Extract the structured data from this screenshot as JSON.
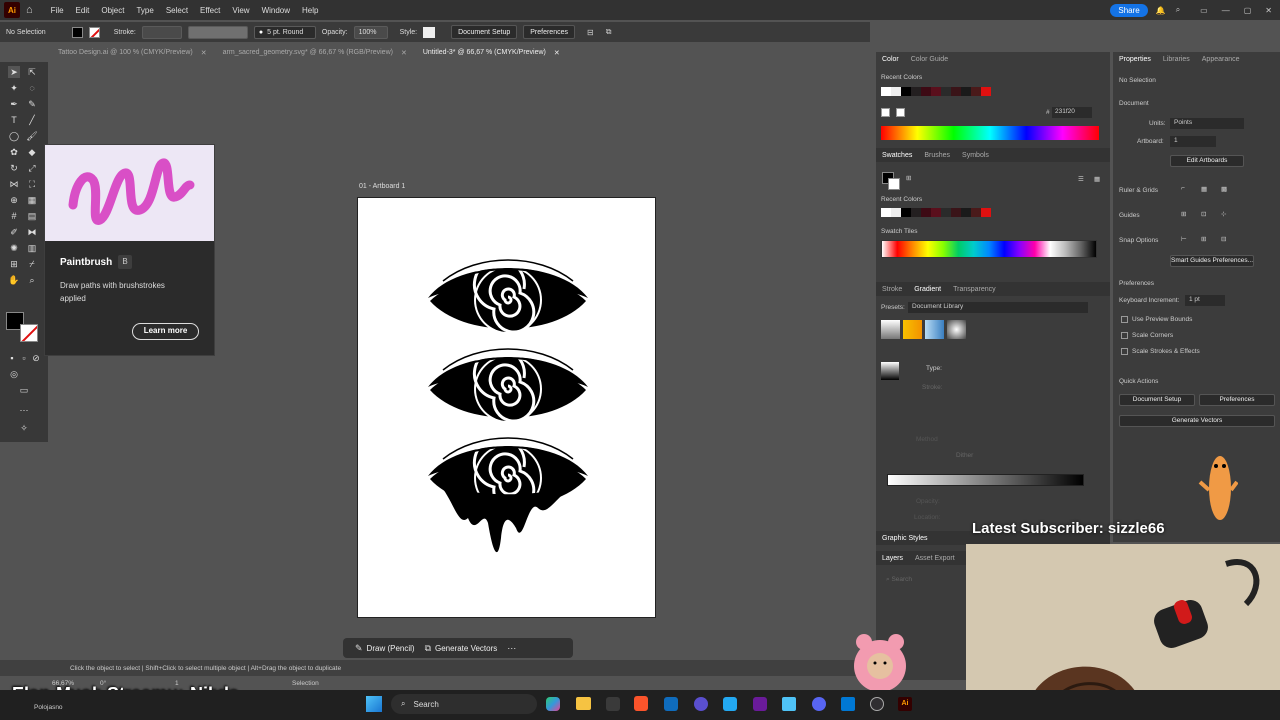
{
  "menubar": {
    "app_icon": "Ai",
    "items": [
      "File",
      "Edit",
      "Object",
      "Type",
      "Select",
      "Effect",
      "View",
      "Window",
      "Help"
    ],
    "share": "Share"
  },
  "control": {
    "selection": "No Selection",
    "stroke_label": "Stroke:",
    "brush": "5 pt. Round",
    "opacity_label": "Opacity:",
    "opacity_value": "100%",
    "style_label": "Style:",
    "document_setup": "Document Setup",
    "preferences": "Preferences"
  },
  "tabs": [
    {
      "label": "Tattoo Design.ai @ 100 % (CMYK/Preview)"
    },
    {
      "label": "arm_sacred_geometry.svg* @ 66,67 % (RGB/Preview)"
    },
    {
      "label": "Untitled-3* @ 66,67 % (CMYK/Preview)"
    }
  ],
  "artboard": {
    "label": "01 - Artboard 1"
  },
  "tooltip": {
    "title": "Paintbrush",
    "shortcut": "B",
    "desc": "Draw paths with brushstrokes applied",
    "learn_more": "Learn more"
  },
  "color_panel": {
    "tabs": [
      "Color",
      "Color Guide"
    ],
    "recent": "Recent Colors",
    "hex": "231f20"
  },
  "swatches_panel": {
    "tabs": [
      "Swatches",
      "Brushes",
      "Symbols"
    ],
    "recent": "Recent Colors",
    "tiles": "Swatch Tiles"
  },
  "gradient_panel": {
    "tabs": [
      "Stroke",
      "Gradient",
      "Transparency"
    ],
    "presets_label": "Presets:",
    "presets_value": "Document Library",
    "type_label": "Type:",
    "stroke": "Stroke:",
    "method": "Method",
    "dither": "Dither",
    "opacity": "Opacity:",
    "location": "Location:"
  },
  "graphic_styles": "Graphic Styles",
  "layers_panel": {
    "tabs": [
      "Layers",
      "Asset Export"
    ],
    "search": "Search"
  },
  "properties": {
    "tabs": [
      "Properties",
      "Libraries",
      "Appearance"
    ],
    "no_selection": "No Selection",
    "document": "Document",
    "units_label": "Units:",
    "units_value": "Points",
    "artboard_label": "Artboard:",
    "artboard_value": "1",
    "edit_artboards": "Edit Artboards",
    "ruler_grids": "Ruler & Grids",
    "guides": "Guides",
    "snap_options": "Snap Options",
    "smart_guides": "Smart Guides Preferences...",
    "preferences": "Preferences",
    "keyboard_increment": "Keyboard Increment:",
    "keyboard_value": "1 pt",
    "use_preview_bounds": "Use Preview Bounds",
    "scale_corners": "Scale Corners",
    "scale_strokes": "Scale Strokes & Effects",
    "quick_actions": "Quick Actions",
    "document_setup": "Document Setup",
    "prefs_button": "Preferences",
    "generate_vectors": "Generate Vectors"
  },
  "contextbar": {
    "draw": "Draw (Pencil)",
    "generate": "Generate Vectors"
  },
  "status": {
    "hint": "Click the object to select  |  Shift+Click to select multiple object  |  Alt+Drag the object to duplicate",
    "zoom": "66,67%",
    "tool": "Selection",
    "rotation": "0°",
    "page": "1"
  },
  "overlay": {
    "subscriber": "Latest Subscriber: sizzle66",
    "stream": "Elon Musk Streamu: Nikdo",
    "location": "Polojasno"
  },
  "taskbar": {
    "search": "Search"
  },
  "colors": {
    "accent": "#1473e6",
    "red": "#e01010",
    "tooltip_art": "#d94fc6"
  }
}
